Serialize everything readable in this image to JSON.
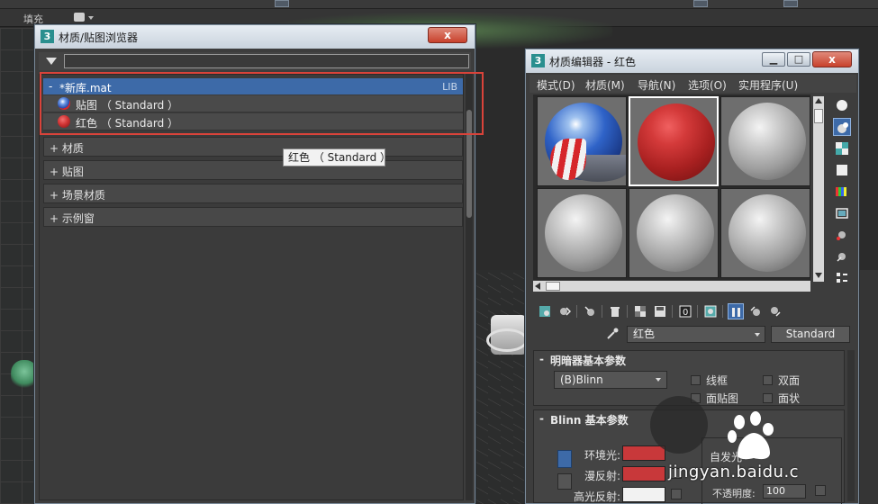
{
  "toolbar": {
    "fill_label": "填充"
  },
  "browser": {
    "title": "材质/贴图浏览器",
    "close_label": "x",
    "search_value": "",
    "library": {
      "toggle": "-",
      "name": "*新库.mat",
      "tag": "LIB",
      "items": [
        {
          "label": "贴图 （ Standard ）",
          "icon": "texture-material-icon"
        },
        {
          "label": "红色 （ Standard ）",
          "icon": "red-material-icon"
        }
      ]
    },
    "groups": [
      {
        "label": "+ 材质"
      },
      {
        "label": "+ 贴图"
      },
      {
        "label": "+ 场景材质"
      },
      {
        "label": "+ 示例窗"
      }
    ],
    "tooltip": "红色 （ Standard ）"
  },
  "editor": {
    "title": "材质编辑器 - 红色",
    "menu": [
      "模式(D)",
      "材质(M)",
      "导航(N)",
      "选项(O)",
      "实用程序(U)"
    ],
    "slots": [
      {
        "type": "texture",
        "active": false
      },
      {
        "type": "red",
        "active": true
      },
      {
        "type": "gray",
        "active": false
      },
      {
        "type": "gray",
        "active": false
      },
      {
        "type": "gray",
        "active": false
      },
      {
        "type": "gray",
        "active": false
      }
    ],
    "material_name": "红色",
    "material_type": "Standard",
    "shader_rollout": {
      "title": "明暗器基本参数",
      "toggle": "-",
      "shader": "(B)Blinn",
      "checkboxes": [
        "线框",
        "双面",
        "面贴图",
        "面状"
      ]
    },
    "blinn_rollout": {
      "title": "Blinn 基本参数",
      "toggle": "-",
      "selfillum_label": "自发光",
      "ambient_label": "环境光:",
      "diffuse_label": "漫反射:",
      "specular_label": "高光反射:",
      "ambient_color": "#c8383a",
      "diffuse_color": "#c8383a",
      "specular_color": "#f2f2f2",
      "opacity_label": "不透明度:",
      "opacity_value": "100"
    }
  },
  "watermark": {
    "text": "jingyan.baidu.c"
  },
  "colors": {
    "accent_blue": "#3d6aa8",
    "highlight_red": "#d9433a",
    "close_red": "#c8412c"
  }
}
